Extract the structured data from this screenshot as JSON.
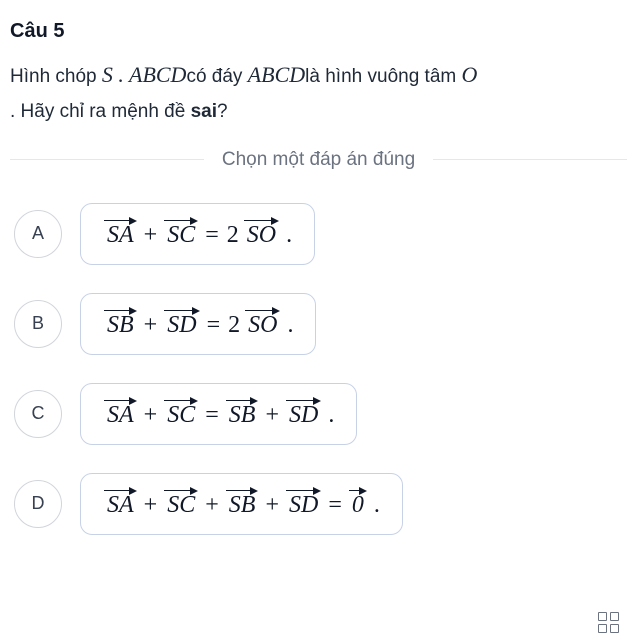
{
  "question": {
    "number": "Câu 5",
    "text_part1": "Hình chóp ",
    "math1": "S . ABCD",
    "text_part2": "có đáy ",
    "math2": "ABCD",
    "text_part3": "là hình vuông tâm ",
    "math3": "O",
    "text_part4": ". Hãy chỉ ra mệnh đề ",
    "bold_word": "sai",
    "text_part5": "?"
  },
  "instruction": "Chọn một đáp án đúng",
  "options": {
    "a": {
      "letter": "A",
      "v1": "SA",
      "op1": "+",
      "v2": "SC",
      "eq": "=",
      "coef": "2",
      "v3": "SO",
      "end": "."
    },
    "b": {
      "letter": "B",
      "v1": "SB",
      "op1": "+",
      "v2": "SD",
      "eq": "=",
      "coef": "2",
      "v3": "SO",
      "end": "."
    },
    "c": {
      "letter": "C",
      "v1": "SA",
      "op1": "+",
      "v2": "SC",
      "eq": "=",
      "v3": "SB",
      "op2": "+",
      "v4": "SD",
      "end": "."
    },
    "d": {
      "letter": "D",
      "v1": "SA",
      "op1": "+",
      "v2": "SC",
      "op2": "+",
      "v3": "SB",
      "op3": "+",
      "v4": "SD",
      "eq": "=",
      "v5": "0",
      "end": "."
    }
  }
}
